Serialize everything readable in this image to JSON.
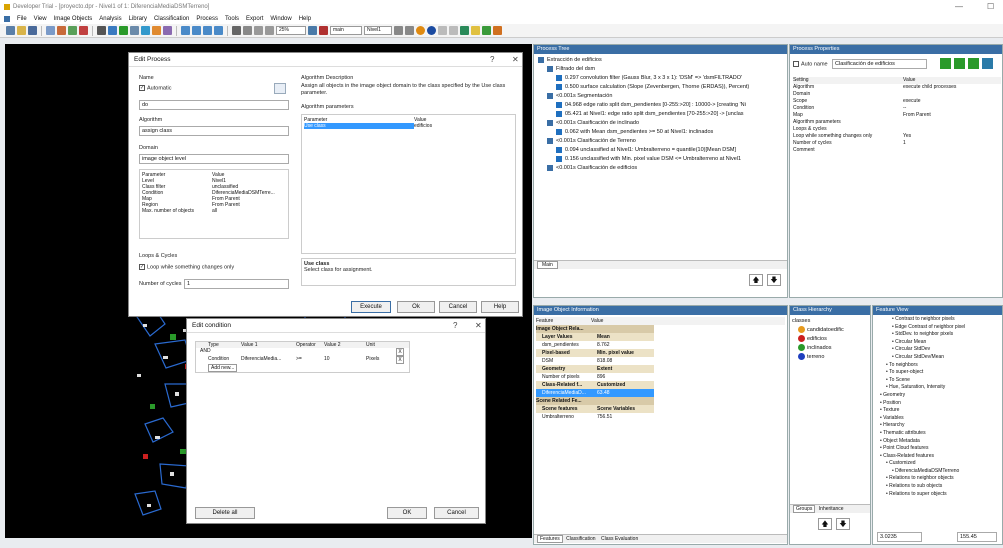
{
  "window": {
    "title": "Developer Trial - [proyecto.dpr - Nivel1 of 1: DiferenciaMediaDSMTerreno]",
    "minimize": "—",
    "maximize": "☐"
  },
  "menu": [
    "File",
    "View",
    "Image Objects",
    "Analysis",
    "Library",
    "Classification",
    "Process",
    "Tools",
    "Export",
    "Window",
    "Help"
  ],
  "toolbar": {
    "zoom": "25%",
    "layer": "main",
    "level": "Nivel1"
  },
  "edit_process": {
    "title": "Edit Process",
    "help": "?",
    "close": "✕",
    "name_label": "Name",
    "automatic": "Automatic",
    "name_value": "do",
    "algorithm_label": "Algorithm",
    "algorithm_value": "assign class",
    "domain_label": "Domain",
    "domain_value": "image object level",
    "param_header": [
      "Parameter",
      "Value"
    ],
    "params": [
      [
        "Level",
        "Nivel1"
      ],
      [
        "Class filter",
        "unclassified"
      ],
      [
        "Condition",
        "DiferenciaMediaDSMTerre..."
      ],
      [
        "Map",
        "From Parent"
      ],
      [
        "Region",
        "From Parent"
      ],
      [
        "Max. number of objects",
        "all"
      ]
    ],
    "desc_label": "Algorithm Description",
    "desc_text": "Assign all objects in the image object domain to the class specified by the Use class parameter.",
    "algo_params_label": "Algorithm parameters",
    "algo_param_header": [
      "Parameter",
      "Value"
    ],
    "algo_params": [
      [
        "Use class",
        "edificios"
      ]
    ],
    "use_class_title": "Use class",
    "use_class_text": "Select class for assignment.",
    "loops_label": "Loops & Cycles",
    "loop_check": "Loop while something changes only",
    "cycles_label": "Number of cycles",
    "cycles_value": "1",
    "buttons": {
      "execute": "Execute",
      "ok": "Ok",
      "cancel": "Cancel",
      "help": "Help"
    }
  },
  "edit_condition": {
    "title": "Edit condition",
    "help": "?",
    "close": "✕",
    "headers": [
      "Type",
      "Value 1",
      "Operator",
      "Value 2",
      "Unit"
    ],
    "rows": [
      [
        "AND",
        "",
        "",
        "",
        ""
      ],
      [
        "Condition",
        "DiferenciaMedia...",
        ">=",
        "10",
        "Pixels"
      ],
      [
        "Add new...",
        "",
        "",
        "",
        ""
      ]
    ],
    "delete_all": "Delete all",
    "ok": "OK",
    "cancel": "Cancel"
  },
  "process_tree": {
    "title": "Process Tree",
    "items": [
      {
        "indent": 0,
        "text": "Extracción de edificios"
      },
      {
        "indent": 1,
        "text": "Filtrado del dsm"
      },
      {
        "indent": 2,
        "text": "0.297  convolution filter (Gauss Blur, 3 x 3 x 1): 'DSM' => 'dsmFILTRADO'"
      },
      {
        "indent": 2,
        "text": "0.500  surface calculation (Slope (Zevenbergen, Thorne (ERDAS)), Percent)"
      },
      {
        "indent": 1,
        "text": "<0.001s  Segmentación"
      },
      {
        "indent": 2,
        "text": "04.968  edge ratio split dsm_pendientes [0-255:>20] : 10000-> [creating 'Ni"
      },
      {
        "indent": 2,
        "text": "05.421  at Nivel1: edge ratio split dsm_pendientes [70-255:>20] -> [unclas"
      },
      {
        "indent": 1,
        "text": "<0.001s  Clasificación de inclinado"
      },
      {
        "indent": 2,
        "text": "0.062  with Mean dsm_pendientes >= 50 at Nivel1: inclinados"
      },
      {
        "indent": 1,
        "text": "<0.001s  Clasificación de Terreno"
      },
      {
        "indent": 2,
        "text": "0.094  unclassified at Nivel1: Umbralterreno = quantile(10)[Mean DSM]"
      },
      {
        "indent": 2,
        "text": "0.156  unclassified with Min. pixel value DSM <= Umbralterreno at Nivel1"
      },
      {
        "indent": 1,
        "text": "<0.001s  Clasificación de edificios"
      }
    ],
    "tab": "Main"
  },
  "process_properties": {
    "title": "Process Properties",
    "auto_name": "Auto name",
    "name_value": "Clasificación de edificios",
    "header": [
      "Setting",
      "Value"
    ],
    "rows": [
      [
        "Algorithm",
        "execute child processes"
      ],
      [
        "Domain",
        ""
      ],
      [
        "Scope",
        "execute"
      ],
      [
        "Condition",
        "--"
      ],
      [
        "Map",
        "From Parent"
      ],
      [
        "Algorithm parameters",
        ""
      ],
      [
        "Loops & cycles",
        ""
      ],
      [
        "Loop while something changes only",
        "Yes"
      ],
      [
        "Number of cycles",
        "1"
      ],
      [
        "Comment",
        ""
      ]
    ]
  },
  "image_object_info": {
    "title": "Image Object Information",
    "header": [
      "Feature",
      "Value"
    ],
    "rows": [
      {
        "f": "Image Object Rela...",
        "v": "",
        "style": "group"
      },
      {
        "f": "Layer Values",
        "v": "Mean",
        "style": "sub"
      },
      {
        "f": "dsm_pendientes",
        "v": "8.762",
        "style": ""
      },
      {
        "f": "Pixel-based",
        "v": "Min. pixel value",
        "style": "sub"
      },
      {
        "f": "DSM",
        "v": "818.08",
        "style": ""
      },
      {
        "f": "Geometry",
        "v": "Extent",
        "style": "sub"
      },
      {
        "f": "Number of pixels",
        "v": "896",
        "style": ""
      },
      {
        "f": "Class-Related f...",
        "v": "Customized",
        "style": "sub"
      },
      {
        "f": "DiferenciaMediaD...",
        "v": "63.48",
        "style": "sel"
      },
      {
        "f": "Scene Related Fe...",
        "v": "",
        "style": "group"
      },
      {
        "f": "Scene features",
        "v": "Scene Variables",
        "style": "sub"
      },
      {
        "f": "Umbralterreno",
        "v": "756.51",
        "style": ""
      }
    ],
    "tabs": [
      "Features",
      "Classification",
      "Class Evaluation"
    ]
  },
  "class_hierarchy": {
    "title": "Class Hierarchy",
    "root": "classes",
    "classes": [
      {
        "name": "candidatoedific",
        "color": "#e69a1e"
      },
      {
        "name": "edificios",
        "color": "#cc2020"
      },
      {
        "name": "inclinados",
        "color": "#2a9a2a"
      },
      {
        "name": "terreno",
        "color": "#1f3fbf"
      }
    ],
    "tabs": [
      "Groups",
      "Inheritance"
    ]
  },
  "feature_view": {
    "title": "Feature View",
    "items": [
      {
        "i": 3,
        "t": "Contrast to neighbor pixels"
      },
      {
        "i": 3,
        "t": "Edge Contrast of neighbor pixel"
      },
      {
        "i": 3,
        "t": "StdDev. to neighbor pixels"
      },
      {
        "i": 3,
        "t": "Circular Mean"
      },
      {
        "i": 3,
        "t": "Circular StdDev"
      },
      {
        "i": 3,
        "t": "Circular StdDev/Mean"
      },
      {
        "i": 2,
        "t": "To neighbors"
      },
      {
        "i": 2,
        "t": "To super-object"
      },
      {
        "i": 2,
        "t": "To Scene"
      },
      {
        "i": 2,
        "t": "Hue, Saturation, Intensity"
      },
      {
        "i": 1,
        "t": "Geometry"
      },
      {
        "i": 1,
        "t": "Position"
      },
      {
        "i": 1,
        "t": "Texture"
      },
      {
        "i": 1,
        "t": "Variables"
      },
      {
        "i": 1,
        "t": "Hierarchy"
      },
      {
        "i": 1,
        "t": "Thematic attributes"
      },
      {
        "i": 1,
        "t": "Object Metadata"
      },
      {
        "i": 1,
        "t": "Point Cloud features"
      },
      {
        "i": 1,
        "t": "Class-Related features"
      },
      {
        "i": 2,
        "t": "Customized"
      },
      {
        "i": 3,
        "t": "DiferenciaMediaDSMTerreno"
      },
      {
        "i": 2,
        "t": "Relations to neighbor objects"
      },
      {
        "i": 2,
        "t": "Relations to sub objects"
      },
      {
        "i": 2,
        "t": "Relations to super objects"
      }
    ],
    "value1": "3.0235",
    "value2": "155.45"
  },
  "colors": {
    "accent": "#3a6ea5",
    "selection": "#3399ff"
  }
}
